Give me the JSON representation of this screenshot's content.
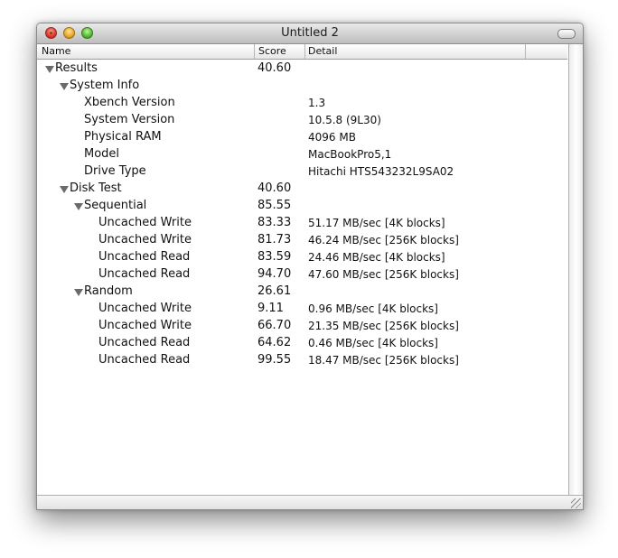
{
  "window": {
    "title": "Untitled 2"
  },
  "columns": {
    "name": "Name",
    "score": "Score",
    "detail": "Detail"
  },
  "rows": [
    {
      "name": "Results",
      "score": "40.60",
      "detail": "",
      "level": 0,
      "disclosure": true
    },
    {
      "name": "System Info",
      "score": "",
      "detail": "",
      "level": 1,
      "disclosure": true
    },
    {
      "name": "Xbench Version",
      "score": "",
      "detail": "1.3",
      "level": 2,
      "disclosure": false
    },
    {
      "name": "System Version",
      "score": "",
      "detail": "10.5.8 (9L30)",
      "level": 2,
      "disclosure": false
    },
    {
      "name": "Physical RAM",
      "score": "",
      "detail": "4096 MB",
      "level": 2,
      "disclosure": false
    },
    {
      "name": "Model",
      "score": "",
      "detail": "MacBookPro5,1",
      "level": 2,
      "disclosure": false
    },
    {
      "name": "Drive Type",
      "score": "",
      "detail": "Hitachi HTS543232L9SA02",
      "level": 2,
      "disclosure": false
    },
    {
      "name": "Disk Test",
      "score": "40.60",
      "detail": "",
      "level": 1,
      "disclosure": true
    },
    {
      "name": "Sequential",
      "score": "85.55",
      "detail": "",
      "level": 2,
      "disclosure": true
    },
    {
      "name": "Uncached Write",
      "score": "83.33",
      "detail": "51.17 MB/sec [4K blocks]",
      "level": 3,
      "disclosure": false
    },
    {
      "name": "Uncached Write",
      "score": "81.73",
      "detail": "46.24 MB/sec [256K blocks]",
      "level": 3,
      "disclosure": false
    },
    {
      "name": "Uncached Read",
      "score": "83.59",
      "detail": "24.46 MB/sec [4K blocks]",
      "level": 3,
      "disclosure": false
    },
    {
      "name": "Uncached Read",
      "score": "94.70",
      "detail": "47.60 MB/sec [256K blocks]",
      "level": 3,
      "disclosure": false
    },
    {
      "name": "Random",
      "score": "26.61",
      "detail": "",
      "level": 2,
      "disclosure": true
    },
    {
      "name": "Uncached Write",
      "score": "9.11",
      "detail": "0.96 MB/sec [4K blocks]",
      "level": 3,
      "disclosure": false
    },
    {
      "name": "Uncached Write",
      "score": "66.70",
      "detail": "21.35 MB/sec [256K blocks]",
      "level": 3,
      "disclosure": false
    },
    {
      "name": "Uncached Read",
      "score": "64.62",
      "detail": "0.46 MB/sec [4K blocks]",
      "level": 3,
      "disclosure": false
    },
    {
      "name": "Uncached Read",
      "score": "99.55",
      "detail": "18.47 MB/sec [256K blocks]",
      "level": 3,
      "disclosure": false
    }
  ]
}
